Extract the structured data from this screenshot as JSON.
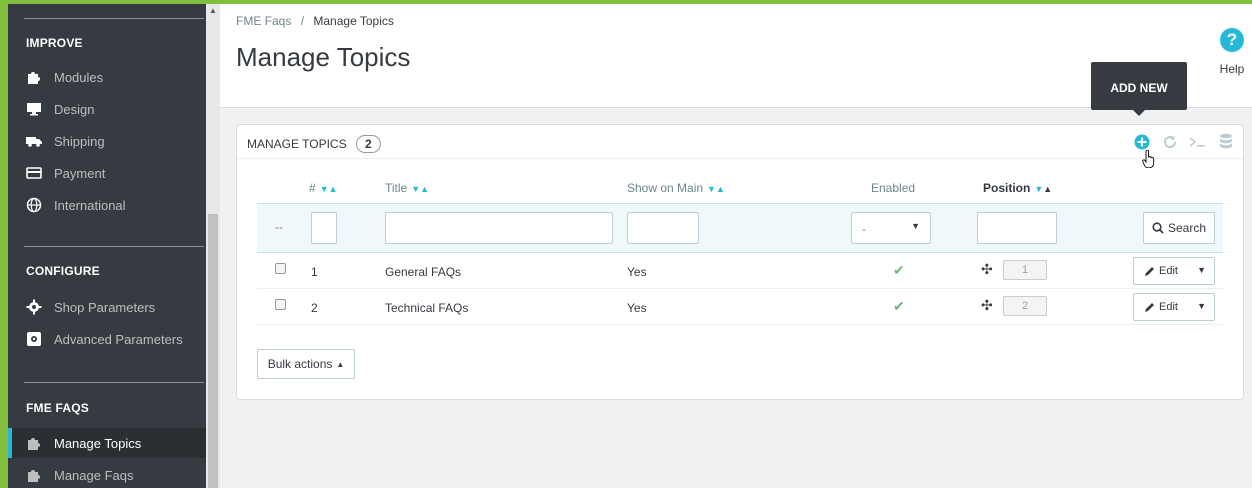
{
  "sidebar": {
    "sections": [
      {
        "title": "IMPROVE",
        "items": [
          "Modules",
          "Design",
          "Shipping",
          "Payment",
          "International"
        ]
      },
      {
        "title": "CONFIGURE",
        "items": [
          "Shop Parameters",
          "Advanced Parameters"
        ]
      },
      {
        "title": "FME FAQS",
        "items": [
          "Manage Topics",
          "Manage Faqs"
        ]
      }
    ],
    "active_item": "Manage Topics",
    "accent": "#25b9d7"
  },
  "header": {
    "breadcrumb": {
      "parent": "FME Faqs",
      "separator": "/",
      "current": "Manage Topics"
    },
    "title": "Manage Topics",
    "help_label": "Help",
    "tooltip": "ADD NEW"
  },
  "panel": {
    "title": "MANAGE TOPICS",
    "count": "2",
    "toolbar_icons": [
      "add-new-icon",
      "refresh-icon",
      "sql-query-icon",
      "export-icon"
    ]
  },
  "table": {
    "columns": {
      "id": "#",
      "title": "Title",
      "show_on_main": "Show on Main",
      "enabled": "Enabled",
      "position": "Position"
    },
    "filter": {
      "bulk_placeholder": "--",
      "enabled_selected": "-",
      "search_label": "Search"
    },
    "rows": [
      {
        "id": "1",
        "title": "General FAQs",
        "show_on_main": "Yes",
        "enabled": true,
        "position": "1",
        "action": "Edit"
      },
      {
        "id": "2",
        "title": "Technical FAQs",
        "show_on_main": "Yes",
        "enabled": true,
        "position": "2",
        "action": "Edit"
      }
    ],
    "bulk_actions_label": "Bulk actions"
  }
}
